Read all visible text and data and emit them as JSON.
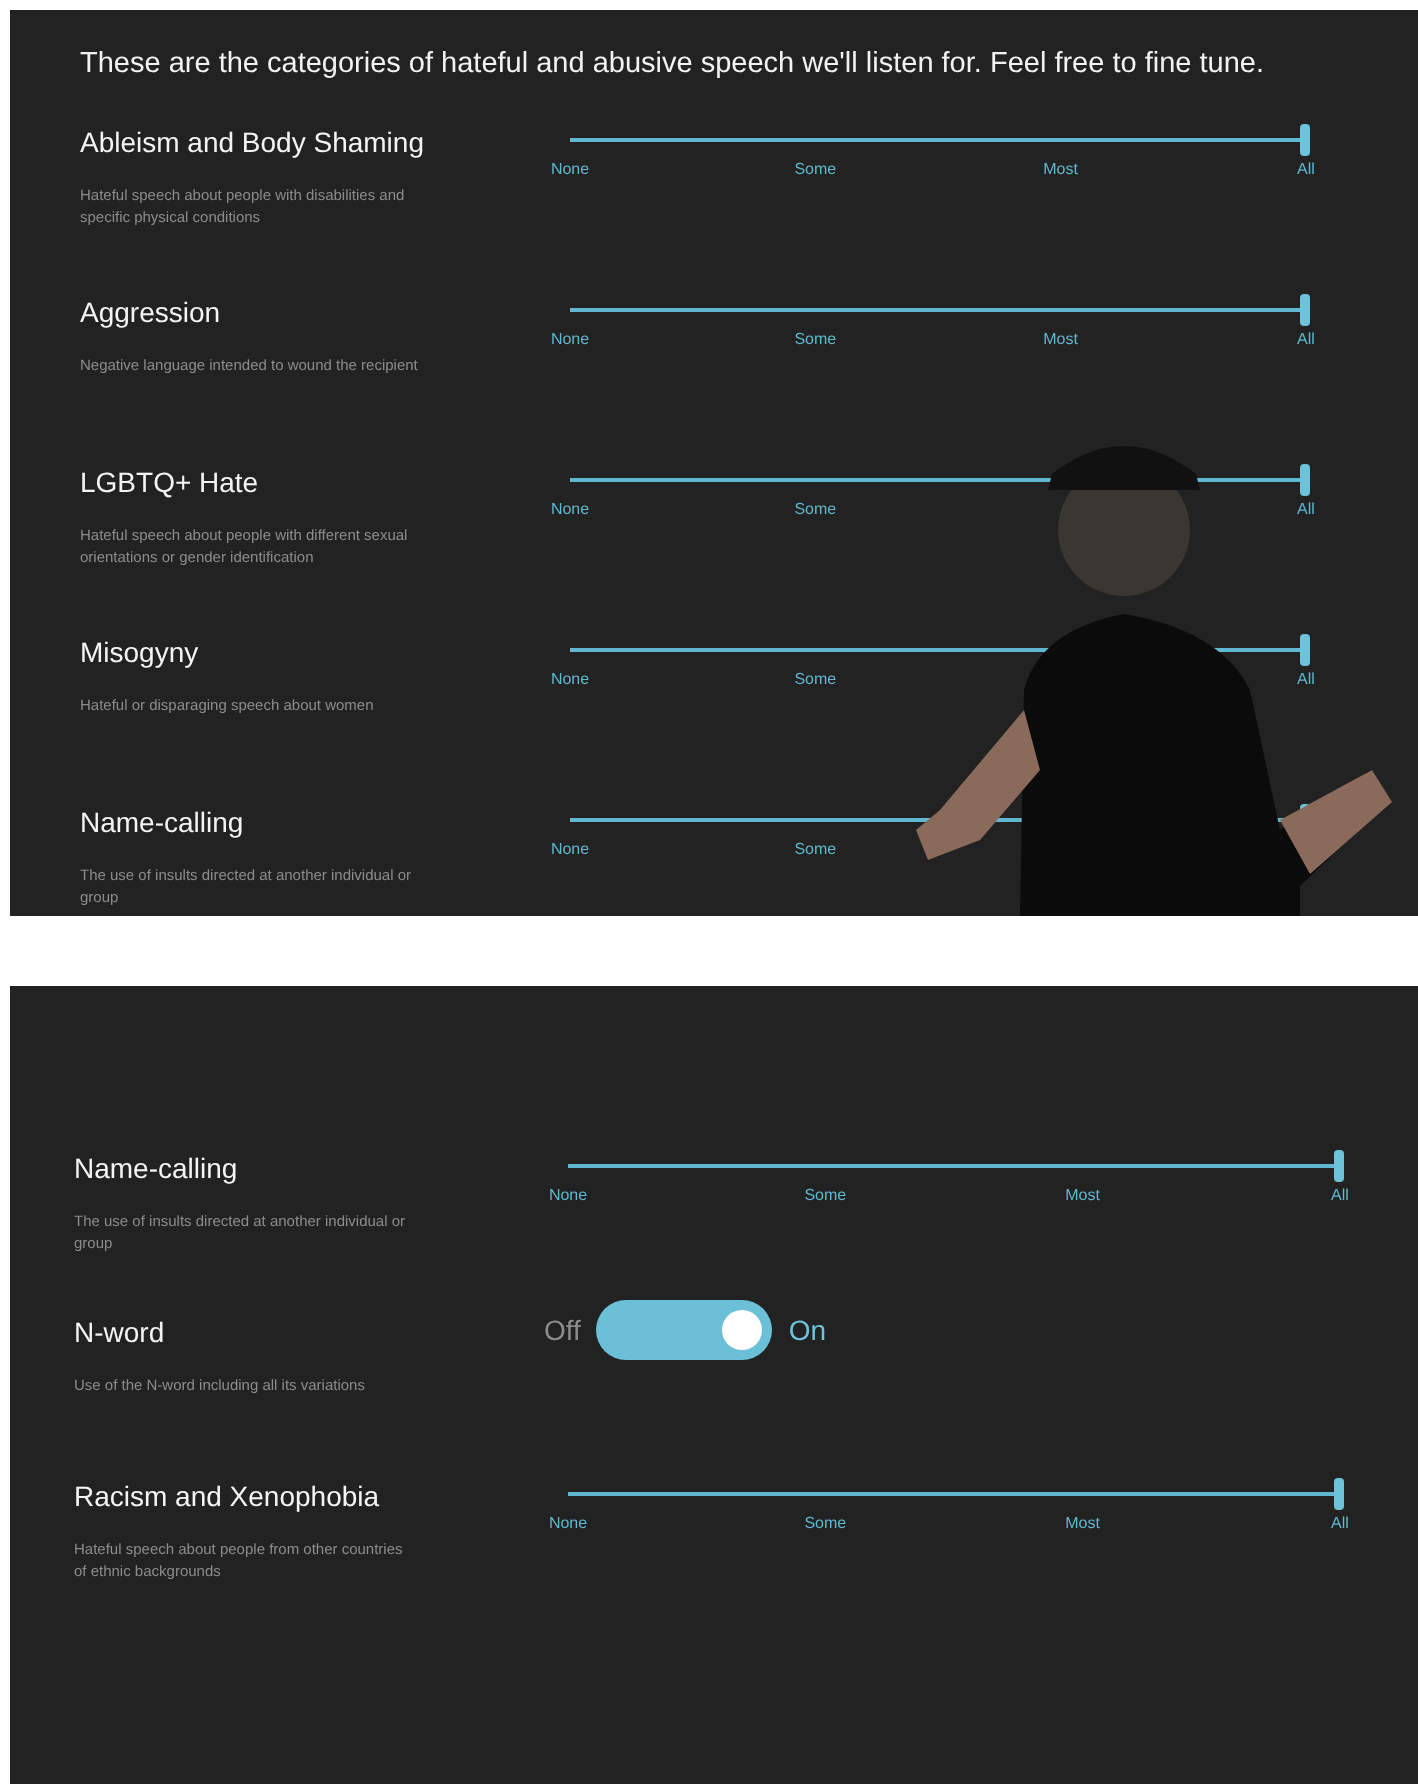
{
  "top_panel": {
    "heading": "These are the categories of hateful and abusive speech we'll listen for. Feel free to fine tune.",
    "categories": [
      {
        "kind": "slider",
        "title": "Ableism and Body Shaming",
        "description": "Hateful speech about people with disabilities and specific physical conditions",
        "level": 1,
        "ticks_left": [
          "None",
          "Some"
        ],
        "ticks_right": [
          "Most",
          "All"
        ]
      },
      {
        "kind": "slider",
        "title": "Aggression",
        "description": "Negative language intended to wound the recipient",
        "level": 1,
        "ticks_left": [
          "None",
          "Some"
        ],
        "ticks_right": [
          "Most",
          "All"
        ]
      },
      {
        "kind": "slider",
        "title": "LGBTQ+ Hate",
        "description": "Hateful speech about people with different sexual orientations or gender identification",
        "level": 1,
        "ticks_left": [
          "None",
          "Some"
        ],
        "ticks_right": [
          "All"
        ]
      },
      {
        "kind": "slider",
        "title": "Misogyny",
        "description": "Hateful or disparaging speech about women",
        "level": 1,
        "ticks_left": [
          "None",
          "Some"
        ],
        "ticks_right": [
          "All"
        ]
      },
      {
        "kind": "slider",
        "title": "Name-calling",
        "description": "The use of insults directed at another individual or group",
        "level": 1,
        "ticks_left": [
          "None",
          "Some"
        ]
      }
    ]
  },
  "bottom_panel": {
    "categories": [
      {
        "kind": "slider",
        "title": "Name-calling",
        "description": "The use of insults directed at another individual or group",
        "level": 1,
        "ticks_left": [
          "None",
          "Some"
        ],
        "ticks_right": [
          "Most",
          "All"
        ]
      },
      {
        "kind": "toggle",
        "title": "N-word",
        "description": "Use of the N-word including all its variations",
        "on": true,
        "off_label": "Off",
        "on_label": "On"
      },
      {
        "kind": "slider",
        "title": "Racism and Xenophobia",
        "description": "Hateful speech about people from other countries of ethnic backgrounds",
        "level": 1,
        "ticks_left": [
          "None",
          "Some"
        ],
        "ticks_right": [
          "Most",
          "All"
        ]
      }
    ]
  }
}
